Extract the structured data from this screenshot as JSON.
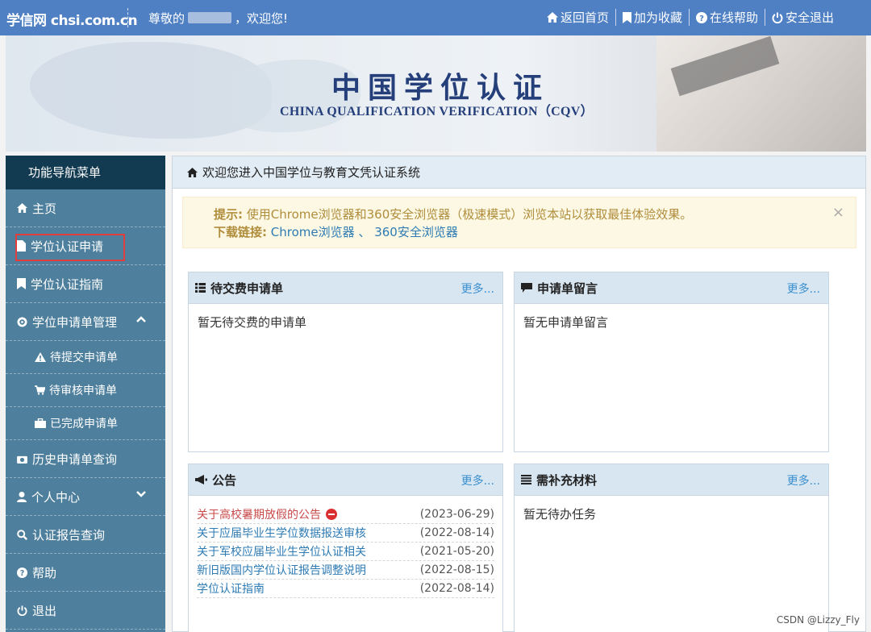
{
  "topbar": {
    "logo": "学信网 chsi.com.cn",
    "greet_prefix": "尊敬的",
    "greet_suffix": "，欢迎您!",
    "links": [
      "返回首页",
      "加为收藏",
      "在线帮助",
      "安全退出"
    ]
  },
  "banner": {
    "title": "中国学位认证",
    "subtitle": "CHINA QUALIFICATION VERIFICATION（CQV）"
  },
  "sidebar": {
    "header": "功能导航菜单",
    "items": {
      "home": "主页",
      "apply": "学位认证申请",
      "guide": "学位认证指南",
      "manage": "学位申请单管理",
      "pending_submit": "待提交申请单",
      "pending_review": "待审核申请单",
      "completed": "已完成申请单",
      "history": "历史申请单查询",
      "personal": "个人中心",
      "report": "认证报告查询",
      "help": "帮助",
      "logout": "退出"
    }
  },
  "main": {
    "header": "欢迎您进入中国学位与教育文凭认证系统",
    "alert": {
      "tip_label": "提示:",
      "tip_text": "使用Chrome浏览器和360安全浏览器（极速模式）浏览本站以获取最佳体验效果。",
      "download_label": "下载链接:",
      "chrome": "Chrome浏览器",
      "sep": "、",
      "browser360": "360安全浏览器",
      "close": "×"
    },
    "panels": {
      "unpaid": {
        "title": "待交费申请单",
        "more": "更多...",
        "empty": "暂无待交费的申请单"
      },
      "messages": {
        "title": "申请单留言",
        "more": "更多...",
        "empty": "暂无申请单留言"
      },
      "notices": {
        "title": "公告",
        "more": "更多...",
        "items": [
          {
            "title": "关于高校暑期放假的公告",
            "date": "(2023-06-29)"
          },
          {
            "title": "关于应届毕业生学位数据报送审核",
            "date": "(2022-08-14)"
          },
          {
            "title": "关于军校应届毕业生学位认证相关",
            "date": "(2021-05-20)"
          },
          {
            "title": "新旧版国内学位认证报告调整说明",
            "date": "(2022-08-15)"
          },
          {
            "title": "学位认证指南",
            "date": "(2022-08-14)"
          }
        ]
      },
      "materials": {
        "title": "需补充材料",
        "more": "更多...",
        "empty": "暂无待办任务"
      }
    }
  },
  "watermark": "CSDN @Lizzy_Fly",
  "colors": {
    "topbar": "#4f80c4",
    "sidebar": "#4e7f9d",
    "sidebar_header": "#123a51",
    "panel_header": "#d8e6f1",
    "link": "#2e7bb4",
    "alert_bg": "#fcf8e3",
    "highlight_border": "#e23d3d"
  }
}
